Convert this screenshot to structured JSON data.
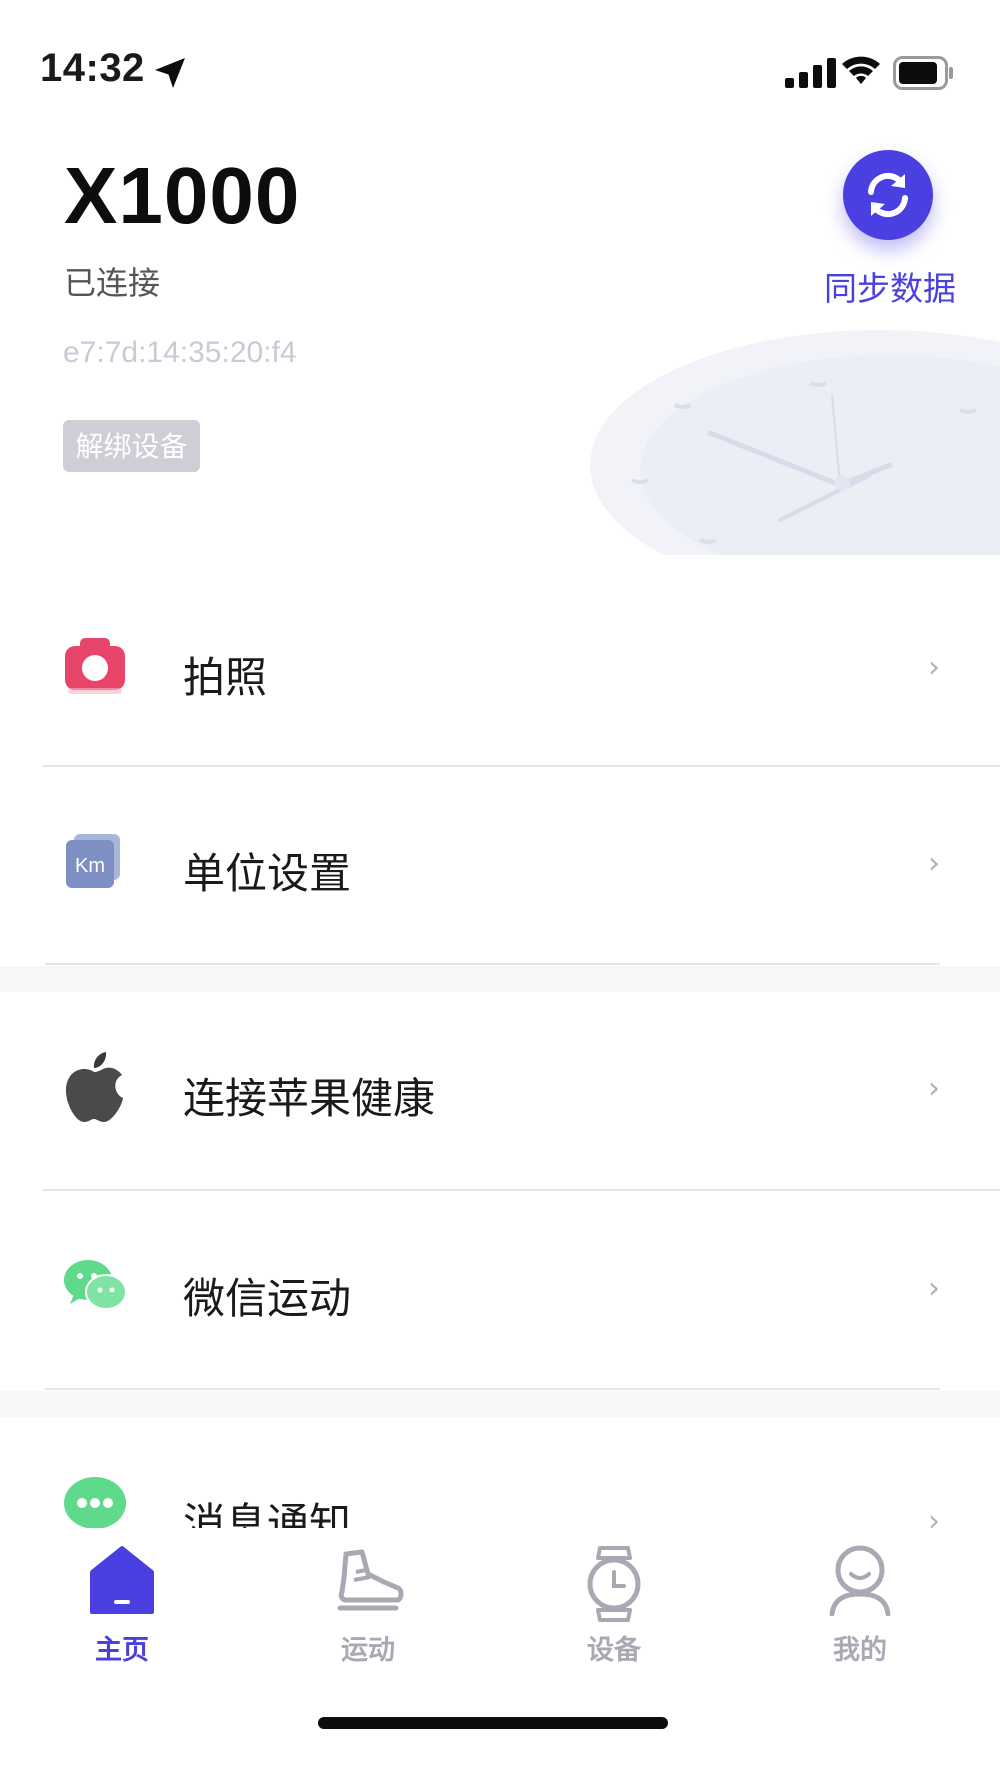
{
  "status_bar": {
    "time": "14:32"
  },
  "header": {
    "device_name": "X1000",
    "connection_status": "已连接",
    "mac_address": "e7:7d:14:35:20:f4",
    "unbind_label": "解绑设备",
    "sync_label": "同步数据"
  },
  "menu": [
    {
      "label": "拍照",
      "icon": "camera-icon"
    },
    {
      "label": "单位设置",
      "icon": "km-unit-icon",
      "icon_text": "Km"
    },
    {
      "label": "连接苹果健康",
      "icon": "apple-icon"
    },
    {
      "label": "微信运动",
      "icon": "wechat-icon"
    },
    {
      "label": "消息通知",
      "icon": "message-icon"
    }
  ],
  "chevron": "›",
  "tab_bar": {
    "tabs": [
      {
        "label": "主页",
        "icon": "home-icon",
        "active": true
      },
      {
        "label": "运动",
        "icon": "sneaker-icon",
        "active": false
      },
      {
        "label": "设备",
        "icon": "watch-icon",
        "active": false
      },
      {
        "label": "我的",
        "icon": "profile-icon",
        "active": false
      }
    ]
  },
  "colors": {
    "accent": "#4a3fe0",
    "camera": "#e8456b",
    "unit": "#7e8fc4",
    "wechat": "#5fd98a",
    "tab_inactive": "#a9a9b4"
  }
}
